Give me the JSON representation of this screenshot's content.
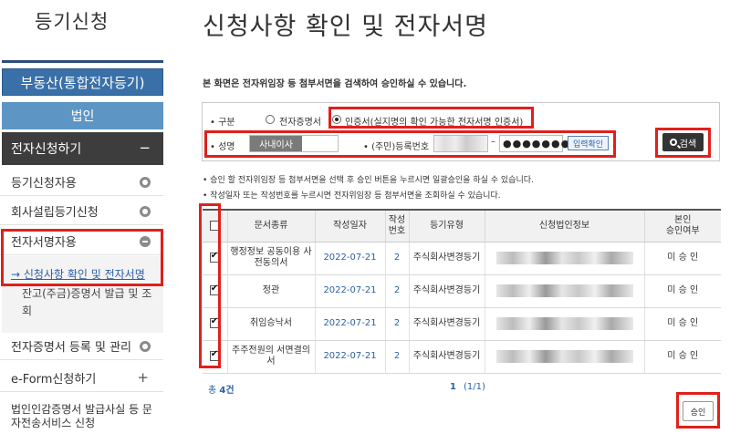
{
  "sidebar": {
    "title": "등기신청",
    "realestate_label": "부동산(통합전자등기)",
    "corporation_label": "법인",
    "apply_label": "전자신청하기",
    "apply_toggle": "−",
    "items": [
      {
        "label": "등기신청자용"
      },
      {
        "label": "회사설립등기신청"
      },
      {
        "label": "전자서명자용"
      }
    ],
    "sub_items": [
      {
        "label": "→ 신청사항 확인 및 전자서명"
      },
      {
        "label": "잔고(주금)증명서 발급 및 조회"
      }
    ],
    "cert_label": "전자증명서 등록 및 관리",
    "eform_label": "e-Form신청하기",
    "eform_toggle": "+",
    "last_label": "법인인감증명서 발급사실 등 문자전송서비스 신청"
  },
  "main": {
    "page_title": "신청사항 확인 및 전자서명",
    "intro": "본 화면은 전자위임장 등 첨부서면을 검색하여 승인하실 수 있습니다.",
    "search": {
      "type_label": "• 구분",
      "radio_cert_doc": "전자증명서",
      "radio_auth_cert": "인증서(실지명의 확인 가능한 전자서명 인증서)",
      "name_label": "• 성명",
      "name_value": "사내이사",
      "reg_label": "• (주민)등록번호",
      "reg_dash": "–",
      "reg_masked": "●●●●●●●",
      "input_confirm": "입력확인",
      "search_button": "검색"
    },
    "notes": [
      "• 승인 할 전자위임장 등 첨부서면을 선택 후 승인 버튼을 누르시면 일괄승인을 하실 수 있습니다.",
      "• 작성일자 또는 작성번호를 누르시면 전자위임장 등 첨부서면을 조회하실 수 있습니다."
    ],
    "table": {
      "headers": [
        "문서종류",
        "작성일자",
        "작성\n번호",
        "등기유형",
        "신청법인정보",
        "본인\n승인여부"
      ],
      "rows": [
        {
          "doc": "행정정보 공동이용 사전동의서",
          "date": "2022-07-21",
          "no": "2",
          "type": "주식회사변경등기",
          "status": "미 승 인"
        },
        {
          "doc": "정관",
          "date": "2022-07-21",
          "no": "2",
          "type": "주식회사변경등기",
          "status": "미 승 인"
        },
        {
          "doc": "취임승낙서",
          "date": "2022-07-21",
          "no": "2",
          "type": "주식회사변경등기",
          "status": "미 승 인"
        },
        {
          "doc": "주주전원의 서면결의서",
          "date": "2022-07-21",
          "no": "2",
          "type": "주식회사변경등기",
          "status": "미 승 인"
        }
      ]
    },
    "total_prefix": "총 ",
    "total_count": "4건",
    "pager_current": "1",
    "pager_text": "(1/1)",
    "approve_button": "승인"
  }
}
